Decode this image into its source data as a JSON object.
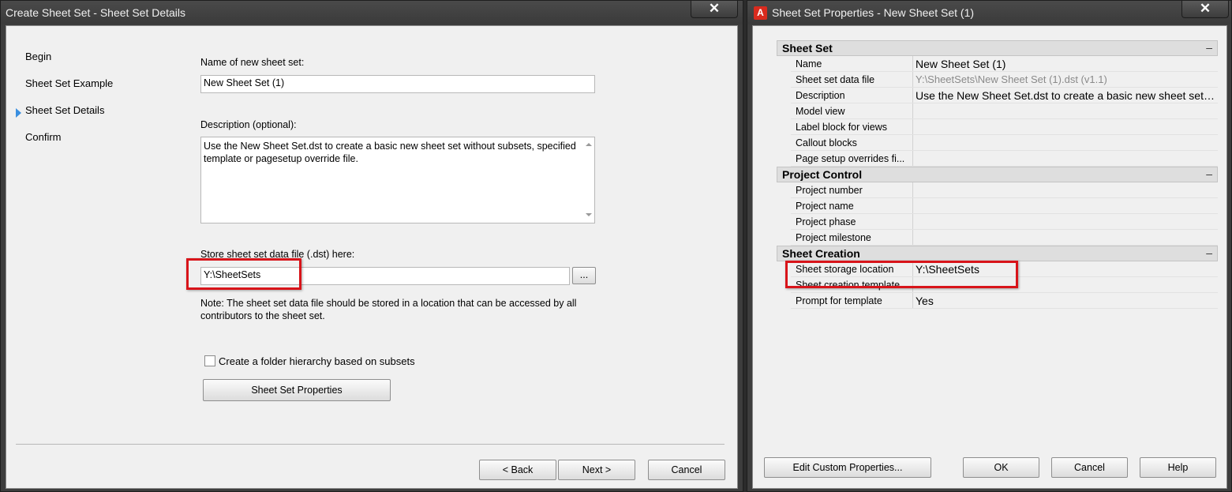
{
  "left_dialog": {
    "title": "Create Sheet Set - Sheet Set Details",
    "close_label": "✕",
    "nav": {
      "items": [
        {
          "label": "Begin"
        },
        {
          "label": "Sheet Set Example"
        },
        {
          "label": "Sheet Set Details"
        },
        {
          "label": "Confirm"
        }
      ],
      "current_index": 2
    },
    "name_label": "Name of new sheet set:",
    "name_value": "New Sheet Set (1)",
    "description_label": "Description (optional):",
    "description_value": "Use the New Sheet Set.dst to create a basic new sheet set without subsets, specified template or pagesetup override file.",
    "store_label": "Store sheet set data file (.dst) here:",
    "store_value": "Y:\\SheetSets",
    "browse_label": "...",
    "note": "Note: The sheet set data file should be stored in a location that can be accessed by all contributors to the sheet set.",
    "folder_checkbox_label": "Create a folder hierarchy based on subsets",
    "folder_checkbox_checked": false,
    "properties_button": "Sheet Set Properties",
    "back_button": "< Back",
    "next_button": "Next >",
    "cancel_button": "Cancel"
  },
  "right_dialog": {
    "title": "Sheet Set Properties - New Sheet Set (1)",
    "app_icon": "A",
    "close_label": "✕",
    "sections": [
      {
        "name": "Sheet Set",
        "collapse": "–",
        "rows": [
          {
            "name": "Name",
            "value": "New Sheet Set (1)"
          },
          {
            "name": "Sheet set data file",
            "value": "Y:\\SheetSets\\New Sheet Set (1).dst (v1.1)"
          },
          {
            "name": "Description",
            "value": "Use the New Sheet Set.dst to create a basic new sheet set without subsets, specified template or pagesetup override file."
          },
          {
            "name": "Model view",
            "value": ""
          },
          {
            "name": "Label block for views",
            "value": ""
          },
          {
            "name": "Callout blocks",
            "value": ""
          },
          {
            "name": "Page setup overrides fi...",
            "value": ""
          }
        ]
      },
      {
        "name": "Project Control",
        "collapse": "–",
        "rows": [
          {
            "name": "Project number",
            "value": ""
          },
          {
            "name": "Project name",
            "value": ""
          },
          {
            "name": "Project phase",
            "value": ""
          },
          {
            "name": "Project milestone",
            "value": ""
          }
        ]
      },
      {
        "name": "Sheet Creation",
        "collapse": "–",
        "rows": [
          {
            "name": "Sheet storage location",
            "value": "Y:\\SheetSets"
          },
          {
            "name": "Sheet creation template",
            "value": ""
          },
          {
            "name": "Prompt for template",
            "value": "Yes"
          }
        ]
      }
    ],
    "edit_custom_button": "Edit Custom Properties...",
    "ok_button": "OK",
    "cancel_button": "Cancel",
    "help_button": "Help"
  },
  "annotation_color": "#d8141a",
  "accent_color": "#3a8fe0"
}
